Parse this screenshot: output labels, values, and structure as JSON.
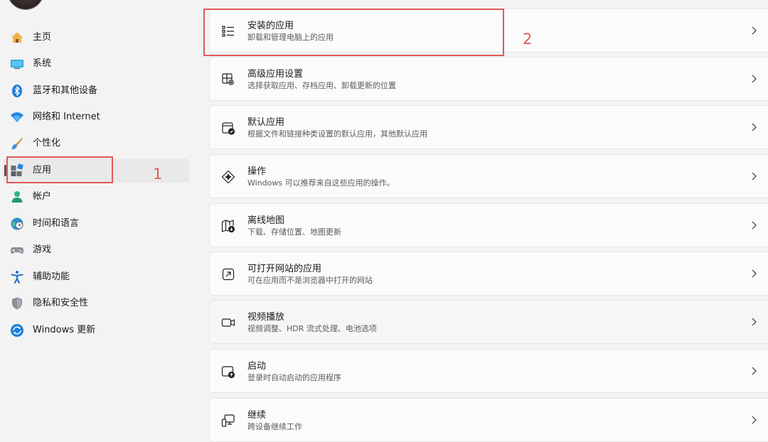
{
  "sidebar": {
    "items": [
      {
        "label": "主页",
        "icon": "home-icon"
      },
      {
        "label": "系统",
        "icon": "monitor-icon"
      },
      {
        "label": "蓝牙和其他设备",
        "icon": "bluetooth-icon"
      },
      {
        "label": "网络和 Internet",
        "icon": "wifi-icon"
      },
      {
        "label": "个性化",
        "icon": "brush-icon"
      },
      {
        "label": "应用",
        "icon": "apps-icon",
        "selected": true
      },
      {
        "label": "帐户",
        "icon": "person-icon"
      },
      {
        "label": "时间和语言",
        "icon": "globe-clock-icon"
      },
      {
        "label": "游戏",
        "icon": "gamepad-icon"
      },
      {
        "label": "辅助功能",
        "icon": "accessibility-icon"
      },
      {
        "label": "隐私和安全性",
        "icon": "shield-icon"
      },
      {
        "label": "Windows 更新",
        "icon": "update-icon"
      }
    ]
  },
  "cards": [
    {
      "title": "安装的应用",
      "subtitle": "卸载和管理电脑上的应用",
      "icon": "list-icon"
    },
    {
      "title": "高级应用设置",
      "subtitle": "选择获取应用、存档应用、卸载更新的位置",
      "icon": "app-gear-icon"
    },
    {
      "title": "默认应用",
      "subtitle": "根据文件和链接种类设置的默认应用，其他默认应用",
      "icon": "default-app-check-icon"
    },
    {
      "title": "操作",
      "subtitle": "Windows 可以推荐来自这些应用的操作。",
      "icon": "sparkle-diamond-icon"
    },
    {
      "title": "离线地图",
      "subtitle": "下载、存储位置、地图更新",
      "icon": "map-download-icon"
    },
    {
      "title": "可打开网站的应用",
      "subtitle": "可在应用而不是浏览器中打开的网站",
      "icon": "open-in-app-icon"
    },
    {
      "title": "视频播放",
      "subtitle": "视频调整、HDR 流式处理、电池选项",
      "icon": "video-camera-icon"
    },
    {
      "title": "启动",
      "subtitle": "登录时自动启动的应用程序",
      "icon": "startup-icon"
    },
    {
      "title": "继续",
      "subtitle": "跨设备继续工作",
      "icon": "continue-devices-icon"
    }
  ],
  "annotations": {
    "label1": "1",
    "label2": "2"
  },
  "colors": {
    "annotation": "#e05a5a",
    "accent": "#0067c0"
  }
}
